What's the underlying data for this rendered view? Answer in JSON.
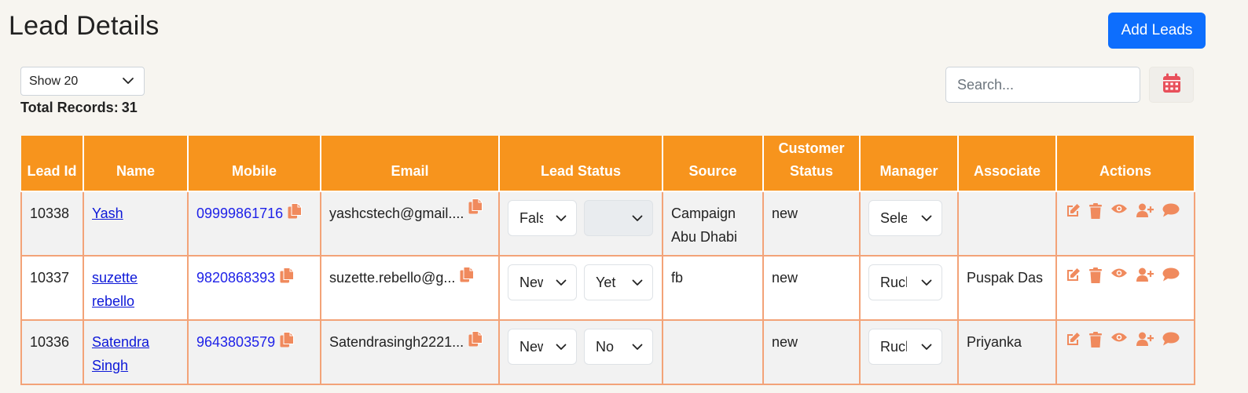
{
  "header": {
    "title": "Lead Details",
    "add_button": "Add Leads"
  },
  "controls": {
    "show_select": "Show 20",
    "total_label": "Total Records:",
    "total_value": "31",
    "search_placeholder": "Search..."
  },
  "table": {
    "columns": [
      "Lead Id",
      "Name",
      "Mobile",
      "Email",
      "Lead Status",
      "Source",
      "Customer Status",
      "Manager",
      "Associate",
      "Actions"
    ],
    "rows": [
      {
        "lead_id": "10338",
        "name": "Yash",
        "mobile": "09999861716",
        "email": "yashcstech@gmail....",
        "status_a": "False",
        "status_b": "",
        "source": "Campaign Abu Dhabi",
        "customer_status": "new",
        "manager": "Select",
        "associate": ""
      },
      {
        "lead_id": "10337",
        "name": "suzette rebello",
        "mobile": "9820868393",
        "email": "suzette.rebello@g...",
        "status_a": "New",
        "status_b": "Yet",
        "source": "fb",
        "customer_status": "new",
        "manager": "Ruchi",
        "associate": "Puspak Das"
      },
      {
        "lead_id": "10336",
        "name": "Satendra Singh",
        "mobile": "9643803579",
        "email": "Satendrasingh2221...",
        "status_a": "New",
        "status_b": "No",
        "source": "",
        "customer_status": "new",
        "manager": "Ruchi",
        "associate": "Priyanka"
      }
    ]
  },
  "colors": {
    "accent": "#0d6efd",
    "header_bg": "#f7941d",
    "border": "#f3a378",
    "action_icon": "#f08a5d",
    "copy_icon": "#f08a5d",
    "calendar_icon": "#e8505b"
  },
  "icons": [
    "chevron-down-icon",
    "calendar-icon",
    "copy-icon",
    "edit-icon",
    "trash-icon",
    "eye-icon",
    "user-plus-icon",
    "comment-icon"
  ]
}
